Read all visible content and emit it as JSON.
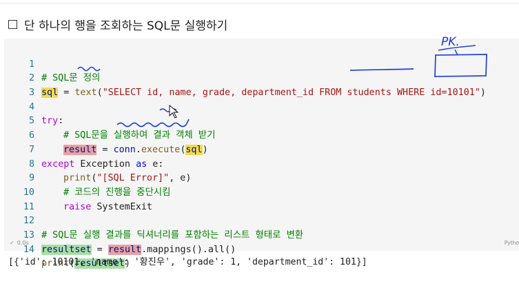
{
  "heading": {
    "text": "단 하나의 행을 조회하는 SQL문 실행하기"
  },
  "code_lines": [
    {
      "no": "1"
    },
    {
      "no": "2"
    },
    {
      "no": "3"
    },
    {
      "no": "4"
    },
    {
      "no": "5"
    },
    {
      "no": "6"
    },
    {
      "no": "7"
    },
    {
      "no": "8"
    },
    {
      "no": "9"
    },
    {
      "no": "10"
    },
    {
      "no": "11"
    },
    {
      "no": "12"
    },
    {
      "no": "13"
    },
    {
      "no": "14"
    }
  ],
  "tokens": {
    "l1_comment": "# SQL문 정의",
    "l2_var": "sql",
    "l2_eq": " = ",
    "l2_fn": "text",
    "l2_open": "(",
    "l2_str": "\"SELECT id, name, grade, department_id FROM students WHERE id=10101\"",
    "l2_close": ")",
    "l4_try": "try",
    "l4_colon": ":",
    "l5_comment": "# SQL문을 실행하여 결과 객체 받기",
    "l6_var": "result",
    "l6_eq": " = ",
    "l6_obj": "conn",
    "l6_dot": ".",
    "l6_fn": "execute",
    "l6_open": "(",
    "l6_arg": "sql",
    "l6_close": ")",
    "l7_except": "except",
    "l7_exc": " Exception ",
    "l7_as": "as",
    "l7_e": " e:",
    "l8_fn": "print",
    "l8_open": "(",
    "l8_str": "\"[SQL Error]\"",
    "l8_rest": ", e)",
    "l9_comment": "# 코드의 진행을 중단시킴",
    "l10_raise": "raise",
    "l10_cls": " SystemExit",
    "l12_comment": "# SQL문 실행 결과를 딕셔너리를 포함하는 리스트 형태로 변환",
    "l13_var": "resultset",
    "l13_eq": " = ",
    "l13_obj": "result",
    "l13_rest": ".mappings().all()",
    "l14_fn": "print",
    "l14_open": "(",
    "l14_arg": "resultset",
    "l14_close": ")"
  },
  "status": {
    "time": "0.0s",
    "language": "Pytho"
  },
  "output": {
    "text": "[{'id': 10101, 'name': '황진우', 'grade': 1, 'department_id': 101}]"
  },
  "annotation": {
    "text": "PK."
  },
  "colors": {
    "comment": "#008000",
    "keyword": "#0000ff",
    "control": "#af00db",
    "string": "#a31515",
    "function": "#795e26",
    "highlight_yellow": "#f1dc4a",
    "highlight_red": "#e8a0a4",
    "highlight_green": "#a9e0a4",
    "ink": "#1f3fd6"
  }
}
